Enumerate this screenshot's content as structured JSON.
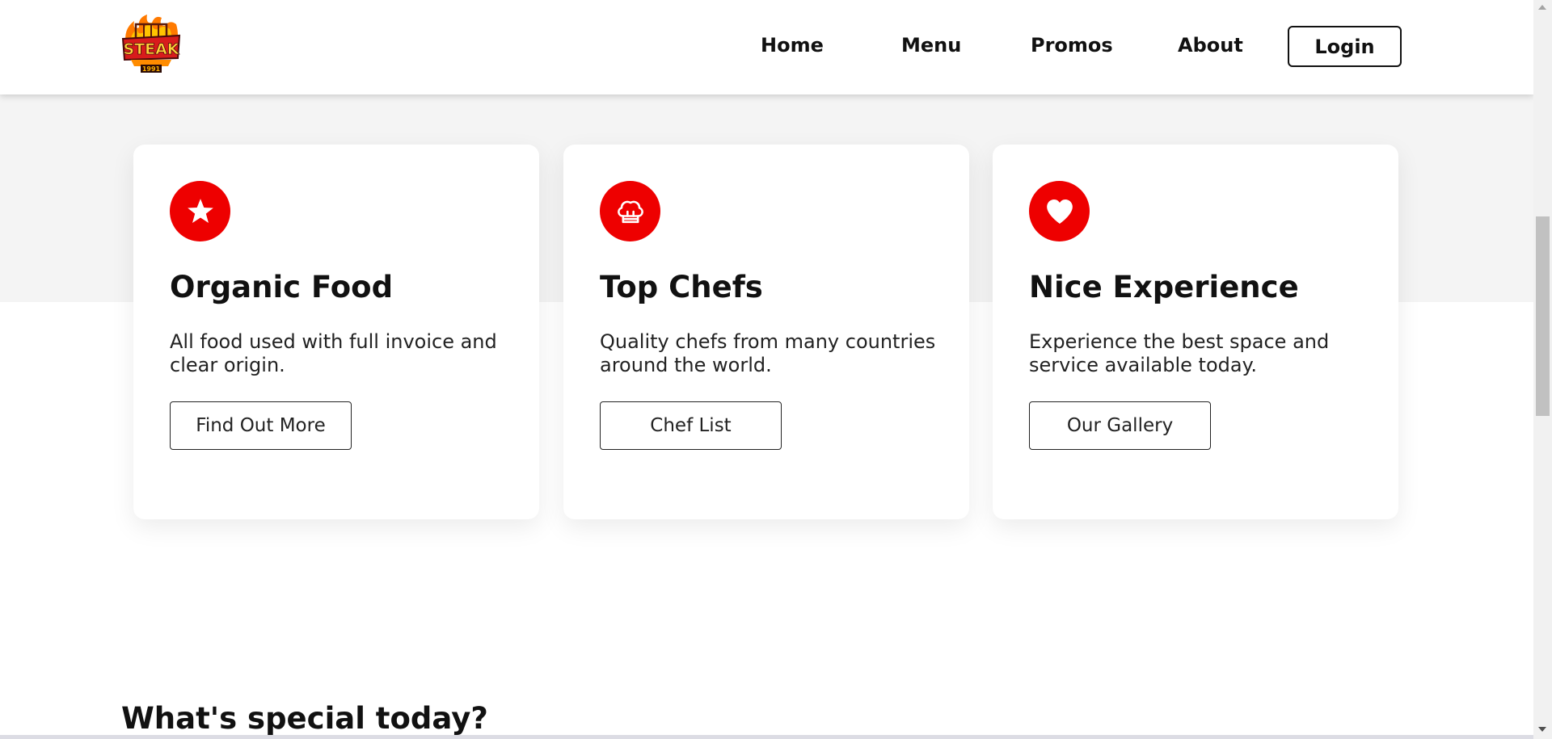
{
  "header": {
    "logo": {
      "text": "STEAK",
      "subtext": "1991"
    },
    "nav": [
      {
        "label": "Home"
      },
      {
        "label": "Menu"
      },
      {
        "label": "Promos"
      },
      {
        "label": "About"
      }
    ],
    "login_label": "Login"
  },
  "features": [
    {
      "icon": "star-icon",
      "title": "Organic Food",
      "description": "All food used with full invoice and clear origin.",
      "button": "Find Out More"
    },
    {
      "icon": "chef-hat-icon",
      "title": "Top Chefs",
      "description": "Quality chefs from many countries around the world.",
      "button": "Chef List"
    },
    {
      "icon": "heart-icon",
      "title": "Nice Experience",
      "description": "Experience the best space and service available today.",
      "button": "Our Gallery"
    }
  ],
  "special_section": {
    "title": "What's special today?"
  },
  "colors": {
    "accent": "#ee0000",
    "text": "#111111",
    "band": "#f4f4f4"
  }
}
